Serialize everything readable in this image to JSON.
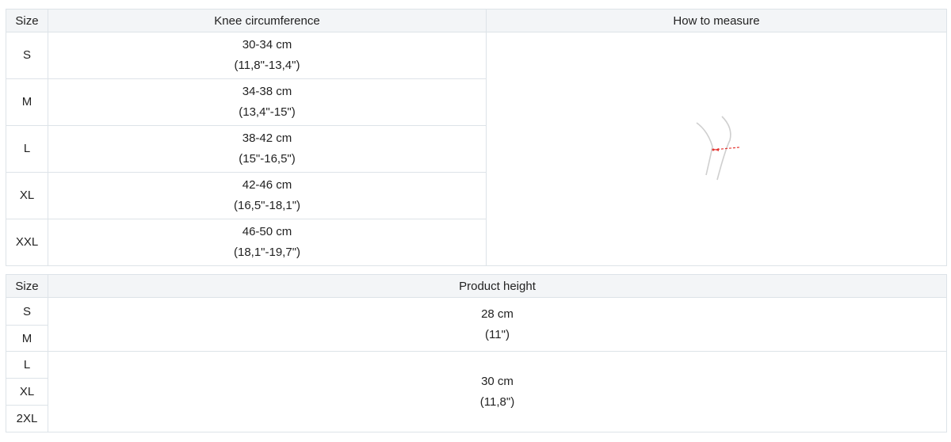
{
  "circumference_table": {
    "headers": {
      "size": "Size",
      "knee": "Knee circumference",
      "measure": "How to measure"
    },
    "rows": [
      {
        "size": "S",
        "cm": "30-34 cm",
        "inch": "(11,8\"-13,4\")"
      },
      {
        "size": "M",
        "cm": "34-38 cm",
        "inch": "(13,4\"-15\")"
      },
      {
        "size": "L",
        "cm": "38-42 cm",
        "inch": "(15\"-16,5\")"
      },
      {
        "size": "XL",
        "cm": "42-46 cm",
        "inch": "(16,5\"-18,1\")"
      },
      {
        "size": "XXL",
        "cm": "46-50 cm",
        "inch": "(18,1\"-19,7\")"
      }
    ],
    "illustration": {
      "icon": "knee-measure-icon",
      "line_color": "#cfcfcf",
      "marker_color": "#e53935"
    }
  },
  "height_table": {
    "headers": {
      "size": "Size",
      "height": "Product height"
    },
    "sizes": [
      "S",
      "M",
      "L",
      "XL",
      "2XL"
    ],
    "groups": [
      {
        "cm": "28 cm",
        "inch": "(11\")"
      },
      {
        "cm": "30 cm",
        "inch": "(11,8\")"
      }
    ]
  }
}
